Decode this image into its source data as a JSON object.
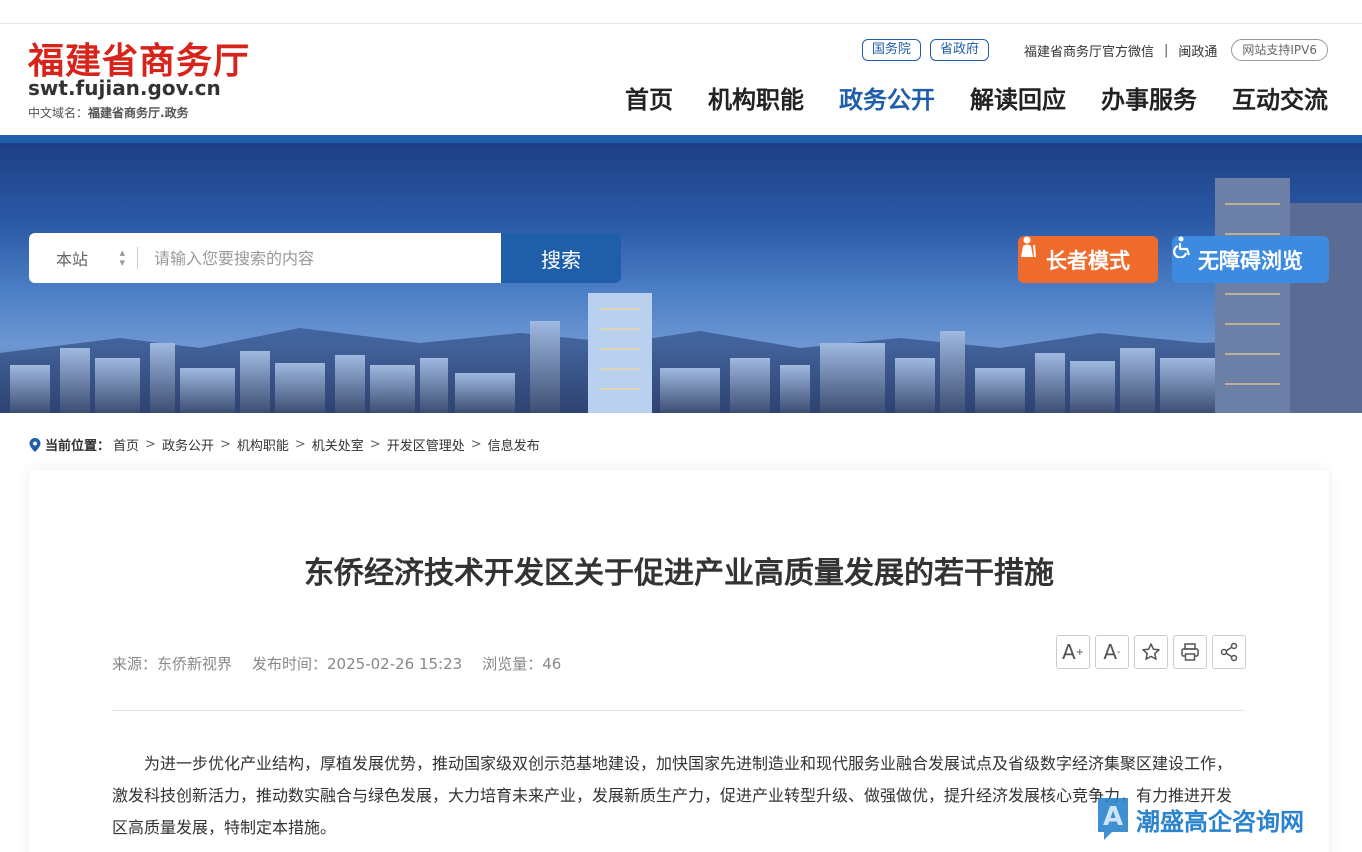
{
  "site": {
    "name_cn": "福建省商务厅",
    "domain": "swt.fujian.gov.cn",
    "cn_domain_label": "中文域名：",
    "cn_domain_value": "福建省商务厅.政务"
  },
  "utility": {
    "link_state_council": "国务院",
    "link_province": "省政府",
    "wechat": "福建省商务厅官方微信",
    "separator": "|",
    "minzhengtong": "闽政通",
    "ipv6": "网站支持IPV6"
  },
  "nav": {
    "items": [
      {
        "label": "首页"
      },
      {
        "label": "机构职能"
      },
      {
        "label": "政务公开"
      },
      {
        "label": "解读回应"
      },
      {
        "label": "办事服务"
      },
      {
        "label": "互动交流"
      }
    ],
    "active_index": 2
  },
  "search": {
    "scope": "本站",
    "placeholder": "请输入您要搜索的内容",
    "button_label": "搜索"
  },
  "accessibility": {
    "elder_mode": "长者模式",
    "barrier_free": "无障碍浏览"
  },
  "breadcrumb": {
    "label": "当前位置：",
    "items": [
      "首页",
      "政务公开",
      "机构职能",
      "机关处室",
      "开发区管理处",
      "信息发布"
    ],
    "arrow": ">"
  },
  "article": {
    "title": "东侨经济技术开发区关于促进产业高质量发展的若干措施",
    "source": "来源：东侨新视界",
    "publish_time": "发布时间：2025-02-26 15:23",
    "views": "浏览量：46",
    "tools": {
      "font_increase": "A",
      "font_decrease": "A",
      "font_increase_sup": "+",
      "font_decrease_sup": "-"
    },
    "paragraph": "为进一步优化产业结构，厚植发展优势，推动国家级双创示范基地建设，加快国家先进制造业和现代服务业融合发展试点及省级数字经济集聚区建设工作，激发科技创新活力，推动数实融合与绿色发展，大力培育未来产业，发展新质生产力，促进产业转型升级、做强做优，提升经济发展核心竞争力，有力推进开发区高质量发展，特制定本措施。"
  },
  "watermark": {
    "text": "潮盛高企咨询网"
  },
  "colors": {
    "brand_red": "#d6241b",
    "brand_blue": "#1f5ea8",
    "elder_orange": "#ef6b2c",
    "access_blue": "#3d8be0"
  }
}
